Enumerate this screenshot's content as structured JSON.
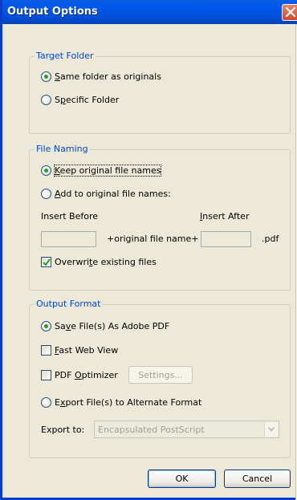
{
  "window": {
    "title": "Output Options",
    "close_icon": "close-x-icon"
  },
  "target_folder": {
    "legend": "Target Folder",
    "options": [
      {
        "label_u": "S",
        "label_rest": "ame folder as originals",
        "checked": true
      },
      {
        "label_pre": "S",
        "label_u": "p",
        "label_rest": "ecific Folder",
        "checked": false
      }
    ]
  },
  "file_naming": {
    "legend": "File Naming",
    "keep_u": "K",
    "keep_rest": "eep original file names",
    "keep_checked": true,
    "add_u": "A",
    "add_rest": "dd to original file names:",
    "add_checked": false,
    "insert_before_label": "Insert Before",
    "insert_after_u": "I",
    "insert_after_rest": "nsert After",
    "insert_before_value": "",
    "insert_after_value": "",
    "middle_text": "+original file name+",
    "ext_text": ".pdf",
    "overwrite_pre": "Overwri",
    "overwrite_u": "t",
    "overwrite_rest": "e existing files",
    "overwrite_checked": true
  },
  "output_format": {
    "legend": "Output Format",
    "save_pre": "Sa",
    "save_u": "v",
    "save_rest": "e File(s) As Adobe PDF",
    "save_checked": true,
    "fast_u": "F",
    "fast_rest": "ast Web View",
    "fast_checked": false,
    "optimizer_pre": "PDF ",
    "optimizer_u": "O",
    "optimizer_rest": "ptimizer",
    "optimizer_checked": false,
    "settings_label": "Settings...",
    "export_pre": "E",
    "export_u": "x",
    "export_rest": "port File(s) to Alternate Format",
    "export_checked": false,
    "export_to_label": "Export to:",
    "export_to_value": "Encapsulated PostScript"
  },
  "buttons": {
    "ok": "OK",
    "cancel": "Cancel"
  },
  "colors": {
    "titlebar": "#0054e3",
    "group_title": "#0046d5",
    "dialog_bg": "#ece9d8"
  }
}
